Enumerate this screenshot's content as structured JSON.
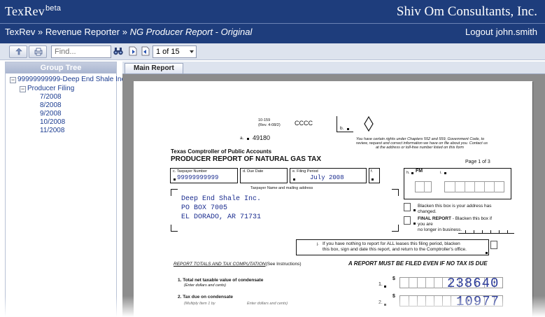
{
  "app": {
    "name": "TexRev",
    "superscript": "beta",
    "company": "Shiv Om Consultants, Inc."
  },
  "breadcrumb": {
    "item1": "TexRev",
    "sep": "»",
    "item2": "Revenue Reporter",
    "current": "NG Producer Report - Original"
  },
  "user": {
    "logout_label": "Logout",
    "username": "john.smith"
  },
  "toolbar": {
    "find_placeholder": "Find...",
    "page_value": "1 of 15",
    "icons": [
      "export-icon",
      "print-icon",
      "binoculars-icon",
      "first-page-icon",
      "next-page-icon"
    ]
  },
  "group_tree": {
    "title": "Group Tree",
    "root": "99999999999-Deep End Shale Inc.",
    "child": "Producer Filing",
    "periods": [
      "7/2008",
      "8/2008",
      "9/2008",
      "10/2008",
      "11/2008"
    ]
  },
  "report": {
    "tab_label": "Main Report",
    "form_no": "10-159",
    "form_rev": "(Rev. 4-08/2)",
    "code": "CCCC",
    "field_a": "a.",
    "field_a_value": "49180",
    "field_b": "b.",
    "rights_line1": "You have certain rights under Chapters 552 and 559, Government Code, to",
    "rights_line2": "review, request and correct information we have on file about you. Contact us",
    "rights_line3": "at the address or toll-free number listed on this form",
    "agency": "Texas Comptroller of Public Accounts",
    "title": "PRODUCER REPORT OF NATURAL GAS TAX",
    "page_of": "Page 1 of 3",
    "c_label": "c. Taxpayer Number",
    "d_label": "d. Due Date",
    "e_label": "e. Filing Period",
    "f_label": "f.",
    "h_label": "h.",
    "fm_label": "FM",
    "i_label": "i.",
    "taxpayer_number": "99999999999",
    "filing_period": "July 2008",
    "name_address_label": "Taxpayer Name and mailing address",
    "name": "Deep End Shale Inc.",
    "address1": "PO BOX 7005",
    "address2": "EL DORADO, AR 71731",
    "addr_change_1": "Blacken this box is your address has",
    "addr_change_2": "changed.",
    "final_report_label": "FINAL REPORT",
    "final_report_1": " - Blacken this box if",
    "final_report_2": "you are",
    "final_report_3": "no longer in business.",
    "j_label": "j.",
    "j_text_1": "If you have nothing to report for ALL leases this filing period, blacken",
    "j_text_2": "this box, sign and date this report, and return to the Comptroller's office.",
    "section_heading": "REPORT TOTALS AND TAX COMPUTATION",
    "section_heading_suffix": "(See Instructions)",
    "must_file": "A REPORT MUST BE FILED EVEN IF NO TAX IS DUE",
    "line1_label": "1. Total net taxable value of condensate",
    "line1_sub": "(Enter dollars and cents)",
    "line1_no": "1.",
    "line1_value": "238640",
    "line2_label": "2. Tax due on condensate",
    "line2_sub_a": "(Multiply Item 1 by",
    "line2_sub_b": "Enter dollars and cents)",
    "line2_no": "2.",
    "line2_value": "10977",
    "dollar": "$"
  }
}
